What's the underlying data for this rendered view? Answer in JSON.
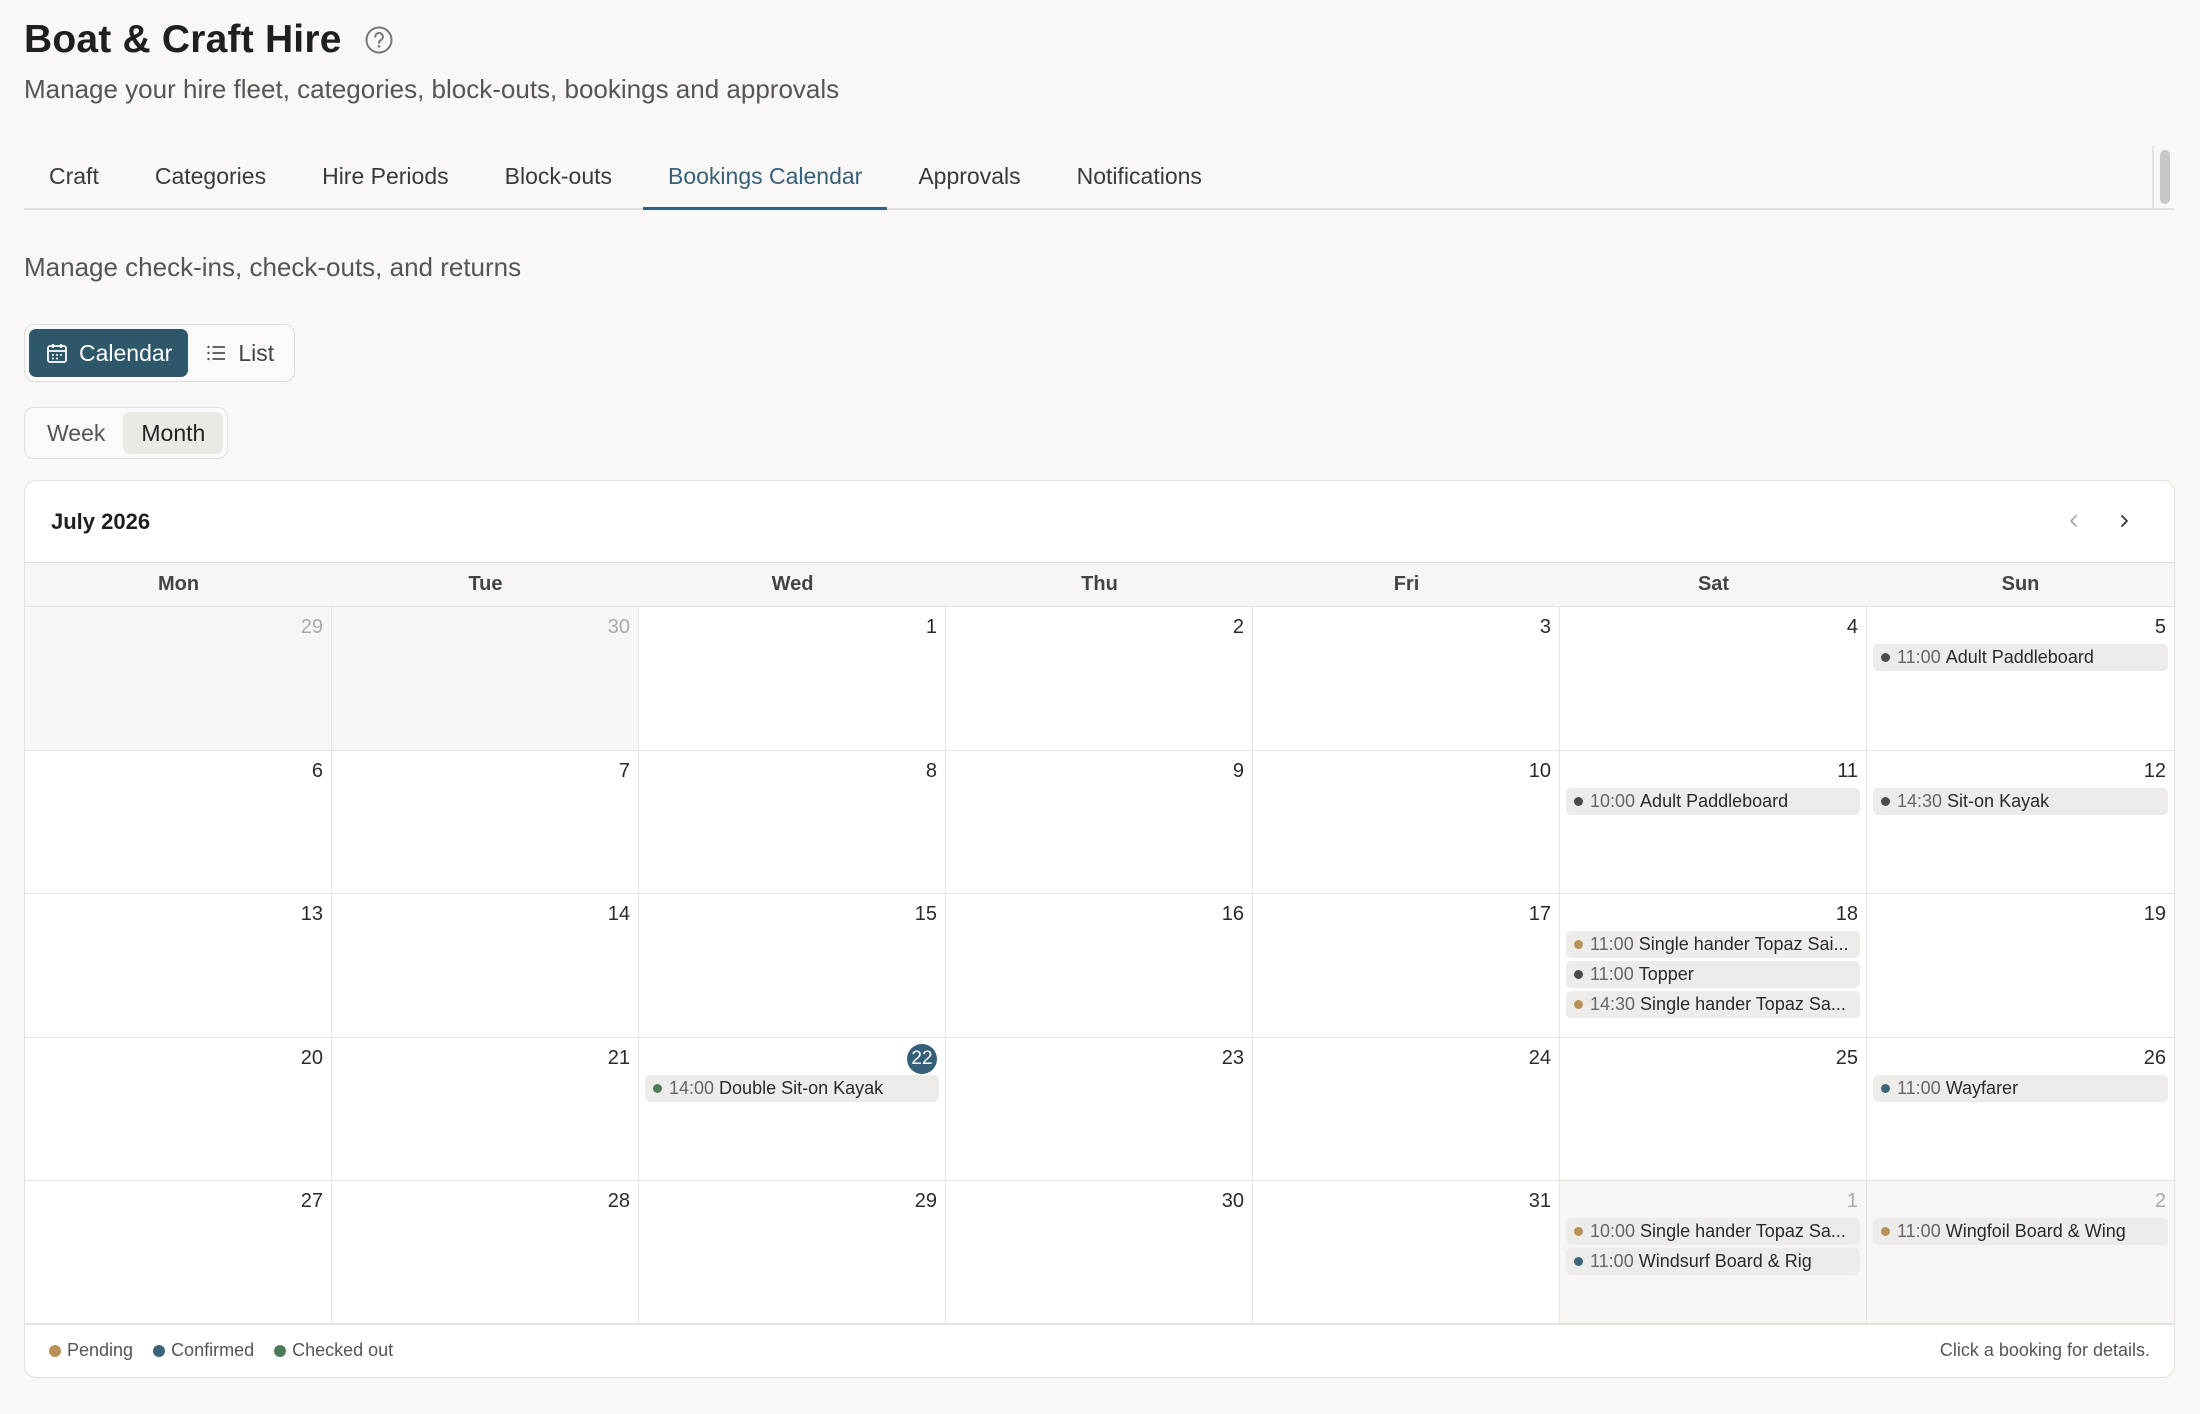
{
  "page": {
    "title": "Boat & Craft Hire",
    "subtitle": "Manage your hire fleet, categories, block-outs, bookings and approvals"
  },
  "tabs": [
    {
      "label": "Craft"
    },
    {
      "label": "Categories"
    },
    {
      "label": "Hire Periods"
    },
    {
      "label": "Block-outs"
    },
    {
      "label": "Bookings Calendar",
      "active": true
    },
    {
      "label": "Approvals"
    },
    {
      "label": "Notifications"
    }
  ],
  "section": {
    "description": "Manage check-ins, check-outs, and returns"
  },
  "view_toggle": {
    "calendar_label": "Calendar",
    "list_label": "List",
    "selected": "Calendar"
  },
  "range_toggle": {
    "week_label": "Week",
    "month_label": "Month",
    "selected": "Month"
  },
  "calendar": {
    "month_label": "July 2026",
    "weekdays": [
      "Mon",
      "Tue",
      "Wed",
      "Thu",
      "Fri",
      "Sat",
      "Sun"
    ],
    "days": [
      {
        "num": "29",
        "outside": true,
        "events": []
      },
      {
        "num": "30",
        "outside": true,
        "events": []
      },
      {
        "num": "1",
        "events": []
      },
      {
        "num": "2",
        "events": []
      },
      {
        "num": "3",
        "events": []
      },
      {
        "num": "4",
        "events": []
      },
      {
        "num": "5",
        "events": [
          {
            "time": "11:00",
            "title": "Adult Paddleboard",
            "status": "default"
          }
        ]
      },
      {
        "num": "6",
        "events": []
      },
      {
        "num": "7",
        "events": []
      },
      {
        "num": "8",
        "events": []
      },
      {
        "num": "9",
        "events": []
      },
      {
        "num": "10",
        "events": []
      },
      {
        "num": "11",
        "events": [
          {
            "time": "10:00",
            "title": "Adult Paddleboard",
            "status": "default"
          }
        ]
      },
      {
        "num": "12",
        "events": [
          {
            "time": "14:30",
            "title": "Sit-on Kayak",
            "status": "default"
          }
        ]
      },
      {
        "num": "13",
        "events": []
      },
      {
        "num": "14",
        "events": []
      },
      {
        "num": "15",
        "events": []
      },
      {
        "num": "16",
        "events": []
      },
      {
        "num": "17",
        "events": []
      },
      {
        "num": "18",
        "events": [
          {
            "time": "11:00",
            "title": "Single hander Topaz Sai...",
            "status": "pending"
          },
          {
            "time": "11:00",
            "title": "Topper",
            "status": "default"
          },
          {
            "time": "14:30",
            "title": "Single hander Topaz Sa...",
            "status": "pending"
          }
        ]
      },
      {
        "num": "19",
        "events": []
      },
      {
        "num": "20",
        "events": []
      },
      {
        "num": "21",
        "events": []
      },
      {
        "num": "22",
        "today": true,
        "events": [
          {
            "time": "14:00",
            "title": "Double Sit-on Kayak",
            "status": "checked_out"
          }
        ]
      },
      {
        "num": "23",
        "events": []
      },
      {
        "num": "24",
        "events": []
      },
      {
        "num": "25",
        "events": []
      },
      {
        "num": "26",
        "events": [
          {
            "time": "11:00",
            "title": "Wayfarer",
            "status": "confirmed"
          }
        ]
      },
      {
        "num": "27",
        "events": []
      },
      {
        "num": "28",
        "events": []
      },
      {
        "num": "29",
        "events": []
      },
      {
        "num": "30",
        "events": []
      },
      {
        "num": "31",
        "events": []
      },
      {
        "num": "1",
        "outside": true,
        "events": [
          {
            "time": "10:00",
            "title": "Single hander Topaz Sa...",
            "status": "pending"
          },
          {
            "time": "11:00",
            "title": "Windsurf Board & Rig",
            "status": "confirmed"
          }
        ]
      },
      {
        "num": "2",
        "outside": true,
        "events": [
          {
            "time": "11:00",
            "title": "Wingfoil Board & Wing",
            "status": "pending"
          }
        ]
      }
    ]
  },
  "legend": [
    {
      "label": "Pending",
      "color": "#b8925a"
    },
    {
      "label": "Confirmed",
      "color": "#3d6478"
    },
    {
      "label": "Checked out",
      "color": "#4e7a5c"
    }
  ],
  "status_colors": {
    "pending": "#b8925a",
    "confirmed": "#3d6478",
    "checked_out": "#4e7a5c",
    "default": "#4a4a4a"
  },
  "footer_hint": "Click a booking for details."
}
